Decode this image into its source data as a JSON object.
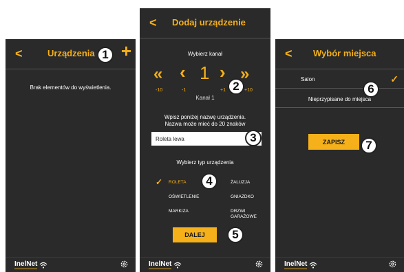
{
  "screen1": {
    "title": "Urządzenia",
    "back": "<",
    "add": "+",
    "empty_message": "Brak elementów do wyświetlenia.",
    "badge": "1"
  },
  "screen2": {
    "title": "Dodaj urządzenie",
    "back": "<",
    "channel_heading": "Wybierz kanał",
    "channel_value": "1",
    "channel_label": "Kanał 1",
    "steps": {
      "minus10": "-10",
      "minus1": "-1",
      "plus1": "+1",
      "plus10": "+10"
    },
    "arrows": {
      "fast_left": "«",
      "left": "‹",
      "right": "›",
      "fast_right": "»"
    },
    "name_help_line1": "Wpisz poniżej nazwę urządzenia.",
    "name_help_line2": "Nazwa może mieć do 20 znaków",
    "name_value": "Roleta lewa",
    "type_heading": "Wybierz typ urządzenia",
    "types": {
      "roleta": "ROLETA",
      "zaluzja": "ŻALUZJA",
      "oswietlenie": "OŚWIETLENIE",
      "gniazdko": "GNIAZDKO",
      "markiza": "MARKIZA",
      "drzwi_line1": "DRZWI",
      "drzwi_line2": "GARAŻOWE"
    },
    "next_button": "DALEJ",
    "badges": {
      "b2": "2",
      "b3": "3",
      "b4": "4",
      "b5": "5"
    }
  },
  "screen3": {
    "title": "Wybór miejsca",
    "back": "<",
    "place1": "Salon",
    "place2": "Nieprzypisane do miejsca",
    "save_button": "ZAPISZ",
    "badges": {
      "b6": "6",
      "b7": "7"
    }
  },
  "footer": {
    "logo": "InelNet"
  },
  "icons": {
    "wifi": "wifi-icon",
    "gear": "gear-icon",
    "check": "check-icon"
  },
  "colors": {
    "accent": "#f5b01a",
    "background": "#2a2a2a"
  }
}
